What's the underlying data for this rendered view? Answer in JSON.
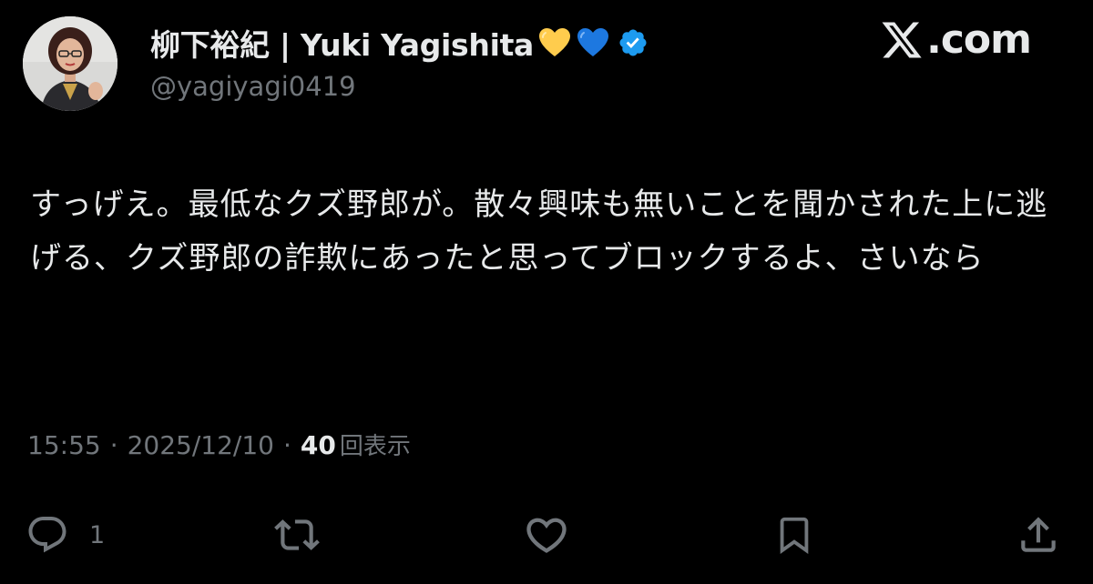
{
  "author": {
    "display_name": "柳下裕紀 | Yuki Yagishita",
    "emojis": [
      "yellow-heart",
      "blue-heart"
    ],
    "verified": true,
    "handle": "@yagiyagi0419"
  },
  "brand": {
    "label": ".com",
    "logo": "x-logo"
  },
  "post": {
    "text": "すっげえ。最低なクズ野郎が。散々興味も無いことを聞かされた上に逃げる、クズ野郎の詐欺にあったと思ってブロックするよ、さいなら",
    "time": "15:55",
    "separator": "·",
    "date": "2025/12/10",
    "views_count": "40",
    "views_label": "回表示"
  },
  "actions": {
    "reply": {
      "icon": "reply-icon",
      "count": "1"
    },
    "repost": {
      "icon": "repost-icon"
    },
    "like": {
      "icon": "heart-icon"
    },
    "bookmark": {
      "icon": "bookmark-icon"
    },
    "share": {
      "icon": "share-icon"
    }
  },
  "colors": {
    "background": "#000000",
    "primary_text": "#e7e9ea",
    "secondary_text": "#71767b",
    "verified_blue": "#1d9bf0",
    "heart_yellow": "#ffcc4d",
    "heart_blue": "#1d78e0"
  }
}
